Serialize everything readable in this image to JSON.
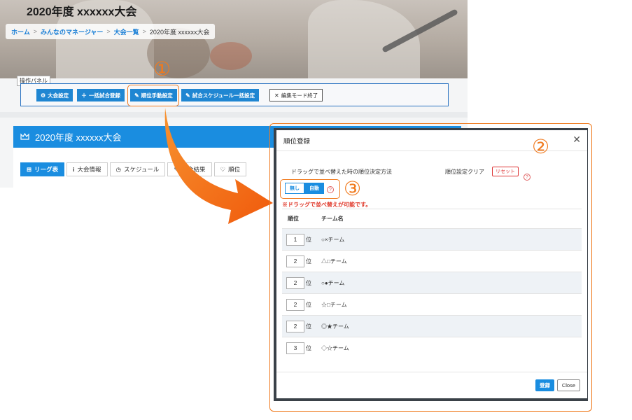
{
  "header": {
    "title": "2020年度 xxxxxx大会",
    "breadcrumb": [
      {
        "label": "ホーム"
      },
      {
        "label": "みんなのマネージャー"
      },
      {
        "label": "大会一覧"
      },
      {
        "label": "2020年度 xxxxxx大会"
      }
    ],
    "breadcrumb_sep": ">"
  },
  "panel": {
    "label": "操作パネル",
    "buttons": [
      {
        "label": "大会設定",
        "icon": "gear-icon",
        "glyph": "⚙"
      },
      {
        "label": "一括試合登録",
        "icon": "plus-icon",
        "glyph": "＋"
      },
      {
        "label": "順位手動設定",
        "icon": "edit-icon",
        "glyph": "✎"
      },
      {
        "label": "試合スケジュール一括設定",
        "icon": "edit-icon",
        "glyph": "✎"
      },
      {
        "label": "編集モード終了",
        "icon": "close-icon",
        "glyph": "✕"
      }
    ]
  },
  "card": {
    "title": "2020年度 xxxxxx大会",
    "icon": "crown-icon",
    "tabs": [
      {
        "label": "リーグ表",
        "glyph": "⊞",
        "active": true
      },
      {
        "label": "大会情報",
        "glyph": "i"
      },
      {
        "label": "スケジュール",
        "glyph": "◷"
      },
      {
        "label": "試合結果",
        "glyph": "✎"
      },
      {
        "label": "順位",
        "glyph": "♡"
      }
    ]
  },
  "callouts": {
    "one": "①",
    "two": "②",
    "three": "③"
  },
  "modal": {
    "title": "順位登録",
    "close_glyph": "✕",
    "sort_method_label": "ドラッグで並べ替えた時の順位決定方法",
    "clear_label": "順位設定クリア",
    "reset_label": "リセット",
    "help_glyph": "?",
    "toggle": {
      "off_label": "無し",
      "on_label": "自動",
      "selected": "自動"
    },
    "notice": "※ドラッグで並べ替えが可能です。",
    "columns": {
      "rank": "順位",
      "team": "チーム名"
    },
    "rank_suffix": "位",
    "rows": [
      {
        "rank": "1",
        "team": "○×チーム"
      },
      {
        "rank": "2",
        "team": "△□チーム"
      },
      {
        "rank": "2",
        "team": "○●チーム"
      },
      {
        "rank": "2",
        "team": "☆□チーム"
      },
      {
        "rank": "2",
        "team": "◎★チーム"
      },
      {
        "rank": "3",
        "team": "◇☆チーム"
      }
    ],
    "register_label": "登録",
    "close_label": "Close"
  },
  "colors": {
    "accent": "#1a8de0",
    "callout": "#f07a1e",
    "arrow": "#f26b12",
    "danger": "#e03a2c"
  }
}
